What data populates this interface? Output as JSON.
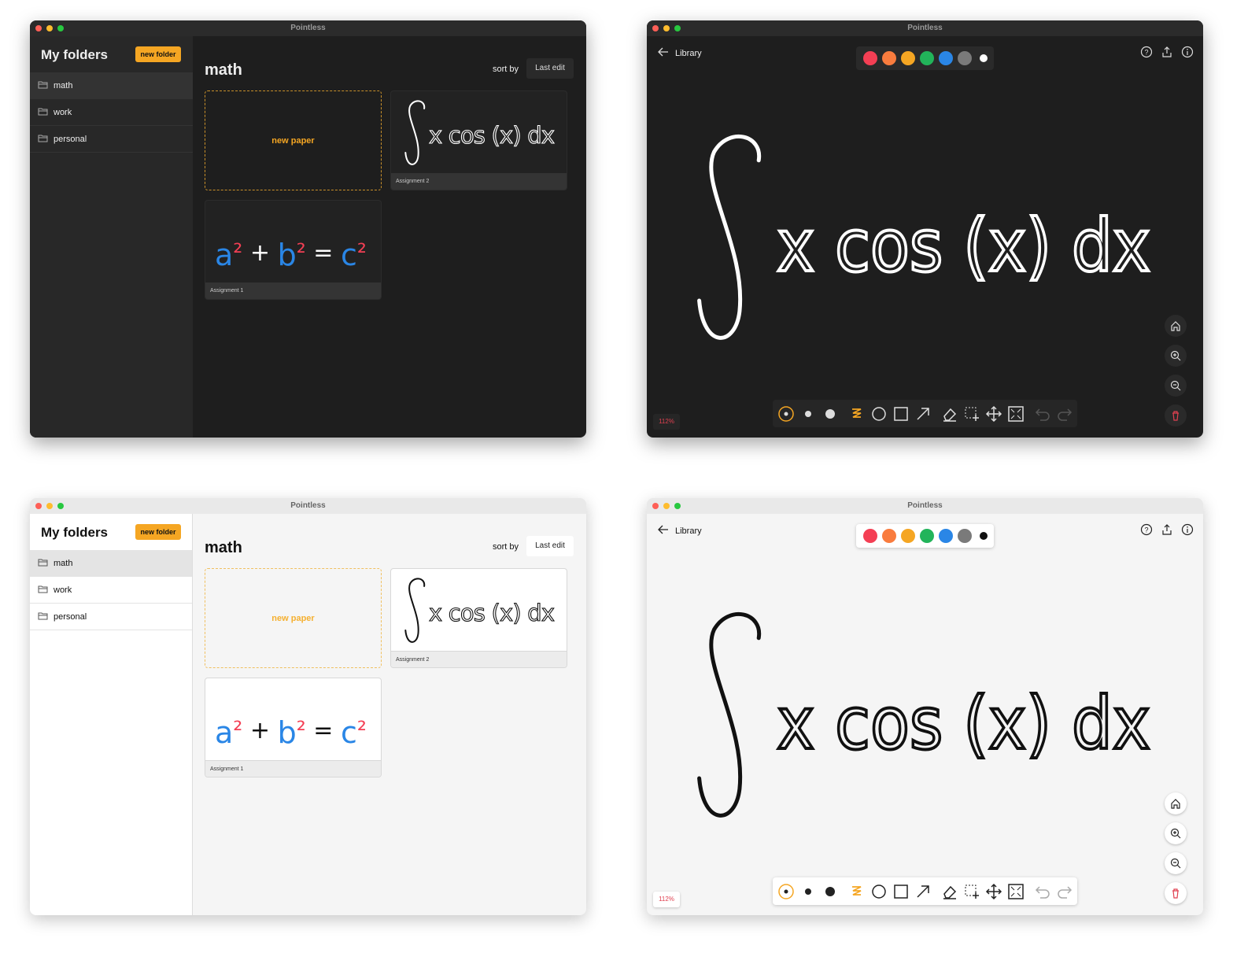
{
  "app_title": "Pointless",
  "colors": {
    "accent": "#f5a623",
    "red": "#f43f54",
    "orange": "#f97c3e",
    "yellow": "#f5a623",
    "green": "#22b45a",
    "blue": "#2a86e6",
    "gray": "#7a7a7a"
  },
  "library": {
    "sidebar_title": "My folders",
    "new_folder_label": "new folder",
    "folders": [
      {
        "label": "math",
        "selected": true
      },
      {
        "label": "work"
      },
      {
        "label": "personal"
      }
    ],
    "folder_icon": "folder-icon",
    "main_title": "math",
    "sort_label": "sort by",
    "sort_value": "Last edit",
    "new_paper_label": "new paper",
    "papers": [
      {
        "name": "Assignment 2",
        "content": "∫ x cos (x) dx"
      },
      {
        "name": "Assignment 1",
        "content": "a² + b² = c²"
      }
    ]
  },
  "editor": {
    "back_label": "Library",
    "palette": [
      "#f43f54",
      "#f97c3e",
      "#f5a623",
      "#22b45a",
      "#2a86e6",
      "#7a7a7a",
      "contrast"
    ],
    "top_icons": [
      "help-icon",
      "share-icon",
      "info-icon"
    ],
    "equation": "x cos (x) dx",
    "side_icons": [
      "home-icon",
      "zoom-in-icon",
      "zoom-out-icon",
      "trash-icon"
    ],
    "toolbar_icons": [
      "pen-small-icon",
      "pen-medium-icon",
      "pen-large-icon",
      "scribble-icon",
      "circle-icon",
      "rectangle-icon",
      "arrow-icon",
      "eraser-icon",
      "select-add-icon",
      "move-icon",
      "fit-screen-icon",
      "undo-icon",
      "redo-icon"
    ],
    "zoom_level": "112%"
  },
  "windows": [
    {
      "theme": "dark",
      "view": "library"
    },
    {
      "theme": "dark",
      "view": "editor"
    },
    {
      "theme": "light",
      "view": "library"
    },
    {
      "theme": "light",
      "view": "editor"
    }
  ]
}
